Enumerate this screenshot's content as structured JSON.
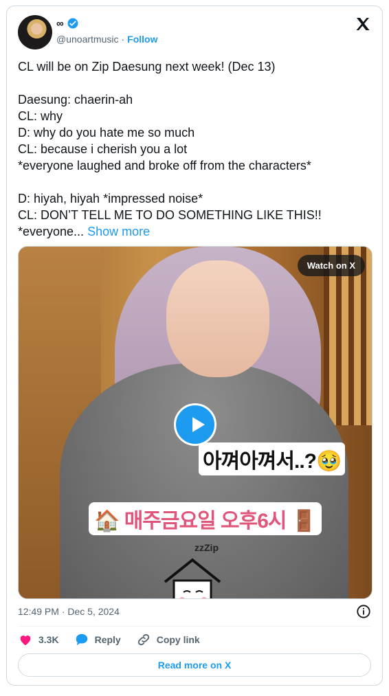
{
  "author": {
    "display_name": "∞",
    "handle": "@unoartmusic",
    "separator": "·",
    "follow_label": "Follow"
  },
  "tweet": {
    "text": "CL will be on Zip Daesung next week! (Dec 13)\n\nDaesung: chaerin-ah\nCL: why\nD: why do you hate me so much\nCL: because i cherish you a lot\n*everyone laughed and broke off from the characters*\n\nD: hiyah, hiyah *impressed noise*\nCL: DON’T TELL ME TO DO SOMETHING LIKE THIS!!\n*everyone... ",
    "show_more": "Show more"
  },
  "media": {
    "watch_label": "Watch on X",
    "caption_top": "아껴아껴서..?🥹",
    "caption_bottom": "🏠 매주금요일 오후6시 🚪",
    "sticker_text": "zzZip"
  },
  "meta": {
    "timestamp": "12:49 PM · Dec 5, 2024"
  },
  "actions": {
    "like_count": "3.3K",
    "reply_label": "Reply",
    "copy_label": "Copy link",
    "read_more_label": "Read more on X"
  },
  "colors": {
    "accent": "#1d9bf0",
    "like": "#f91880",
    "text": "#0f1419",
    "secondary": "#536471"
  }
}
